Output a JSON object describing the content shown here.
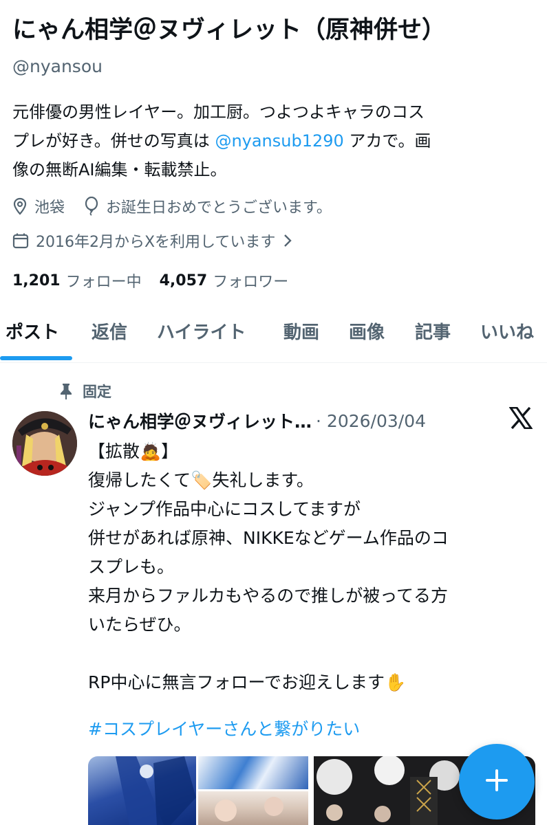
{
  "profile": {
    "display_name": "にゃん相学＠ヌヴィレット（原神併せ）",
    "handle": "@nyansou",
    "bio_1": "元俳優の男性レイヤー。加工厨。つよつよキャラのコス",
    "bio_2a": "プレが好き。併せの写真は ",
    "bio_mention": "@nyansub1290",
    "bio_2b": " アカで。画",
    "bio_3": "像の無断AI編集・転載禁止。",
    "location": "池袋",
    "birthday": "お誕生日おめでとうございます。",
    "joined": "2016年2月からXを利用しています",
    "following_count": "1,201",
    "following_label": "フォロー中",
    "followers_count": "4,057",
    "followers_label": "フォロワー",
    "icons": {
      "location": "location-pin-icon",
      "birthday": "balloon-icon",
      "joined": "calendar-icon",
      "joined_more": "chevron-right-icon"
    }
  },
  "tabs": [
    {
      "label": "ポスト",
      "active": true
    },
    {
      "label": "返信",
      "active": false
    },
    {
      "label": "ハイライト",
      "active": false
    },
    {
      "label": "動画",
      "active": false
    },
    {
      "label": "画像",
      "active": false
    },
    {
      "label": "記事",
      "active": false
    },
    {
      "label": "いいね",
      "active": false
    }
  ],
  "post": {
    "pinned_label": "固定",
    "author": "にゃん相学＠ヌヴィレット…",
    "date": "· 2026/03/04",
    "lines": [
      "【拡散🙇】",
      "復帰したくて🏷️失礼します。",
      "ジャンプ作品中心にコスしてますが",
      "併せがあれば原神、NIKKEなどゲーム作品のコ",
      "スプレも。",
      "来月からファルカもやるので推しが被ってる方",
      "いたらぜひ。",
      "",
      "RP中心に無言フォローでお迎えします✋"
    ],
    "hashtag": "#コスプレイヤーさんと繋がりたい",
    "media_count": 4
  },
  "colors": {
    "accent": "#1d9bf0",
    "text": "#0f1419",
    "secondary": "#536471",
    "divider": "#eff3f4"
  },
  "fab": {
    "icon": "compose-plus-icon"
  }
}
